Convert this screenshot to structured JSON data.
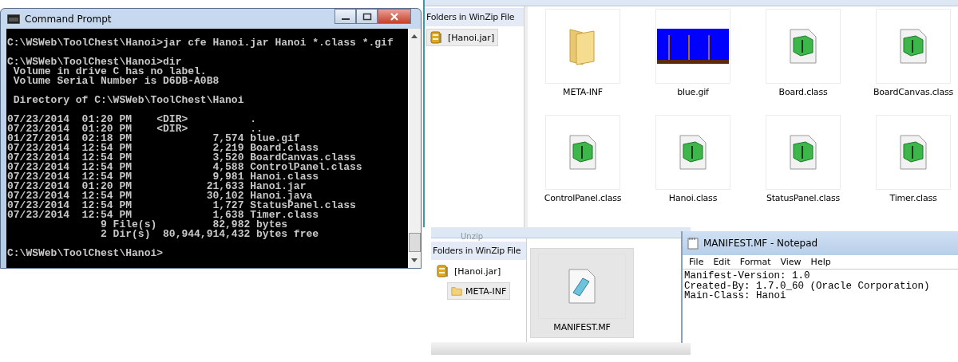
{
  "command_prompt": {
    "title": "Command Prompt",
    "blocks": [
      [
        "C:\\WSWeb\\ToolChest\\Hanoi>jar cfe Hanoi.jar Hanoi *.class *.gif"
      ],
      [
        "C:\\WSWeb\\ToolChest\\Hanoi>dir",
        " Volume in drive C has no label.",
        " Volume Serial Number is D6DB-A0B8"
      ],
      [
        " Directory of C:\\WSWeb\\ToolChest\\Hanoi"
      ],
      [
        "07/23/2014  01:20 PM    <DIR>          .",
        "07/23/2014  01:20 PM    <DIR>          ..",
        "01/27/2014  02:18 PM             7,574 blue.gif",
        "07/23/2014  12:54 PM             2,219 Board.class",
        "07/23/2014  12:54 PM             3,520 BoardCanvas.class",
        "07/23/2014  12:54 PM             4,588 ControlPanel.class",
        "07/23/2014  12:54 PM             9,981 Hanoi.class",
        "07/23/2014  01:20 PM            21,633 Hanoi.jar",
        "07/23/2014  12:54 PM            30,102 Hanoi.java",
        "07/23/2014  12:54 PM             1,727 StatusPanel.class",
        "07/23/2014  12:54 PM             1,638 Timer.class",
        "               9 File(s)         82,982 bytes",
        "               2 Dir(s)  80,944,914,432 bytes free"
      ],
      [
        "C:\\WSWeb\\ToolChest\\Hanoi>"
      ]
    ]
  },
  "winzip_top": {
    "sidebar": {
      "header": "Folders in WinZip File",
      "items": [
        {
          "label": "[Hanoi.jar]",
          "selected": true
        }
      ]
    },
    "files": [
      {
        "name": "META-INF",
        "kind": "folder",
        "selected": false
      },
      {
        "name": "blue.gif",
        "kind": "image",
        "selected": false
      },
      {
        "name": "Board.class",
        "kind": "class",
        "selected": false
      },
      {
        "name": "BoardCanvas.class",
        "kind": "class",
        "selected": false
      },
      {
        "name": "ControlPanel.class",
        "kind": "class",
        "selected": false
      },
      {
        "name": "Hanoi.class",
        "kind": "class",
        "selected": false
      },
      {
        "name": "StatusPanel.class",
        "kind": "class",
        "selected": false
      },
      {
        "name": "Timer.class",
        "kind": "class",
        "selected": false
      }
    ]
  },
  "winzip_bottom": {
    "ribbon_label": "Unzip",
    "sidebar": {
      "header": "Folders in WinZip File",
      "items": [
        {
          "label": "[Hanoi.jar]",
          "selected": false,
          "children": [
            {
              "label": "META-INF",
              "selected": true
            }
          ]
        }
      ]
    },
    "files": [
      {
        "name": "MANIFEST.MF",
        "kind": "text",
        "selected": true
      }
    ]
  },
  "notepad": {
    "title": "MANIFEST.MF - Notepad",
    "menu": [
      "File",
      "Edit",
      "Format",
      "View",
      "Help"
    ],
    "lines": [
      "Manifest-Version: 1.0",
      "Created-By: 1.7.0_60 (Oracle Corporation)",
      "Main-Class: Hanoi"
    ]
  }
}
